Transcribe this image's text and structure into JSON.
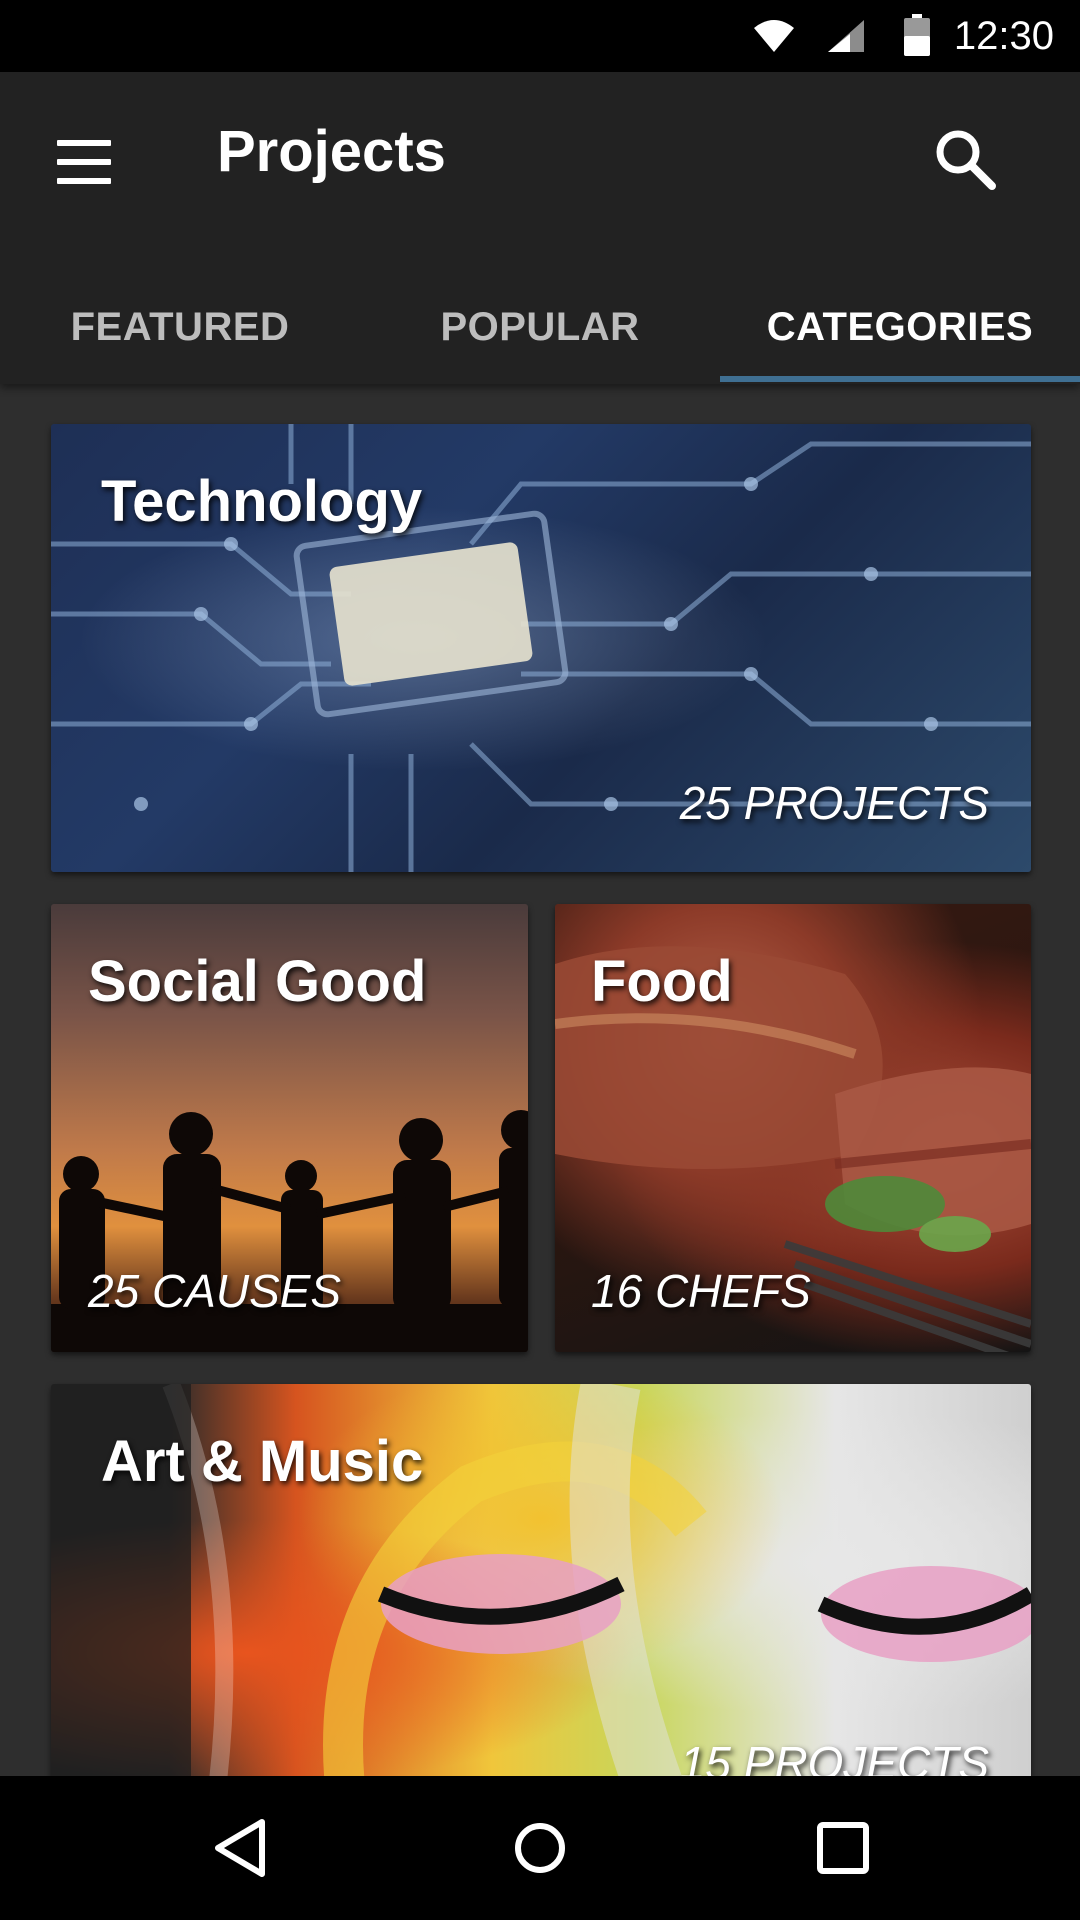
{
  "status_bar": {
    "time": "12:30",
    "icons": [
      "wifi-icon",
      "cell-signal-icon",
      "battery-icon"
    ]
  },
  "app_bar": {
    "title": "Projects",
    "menu_icon": "hamburger-menu-icon",
    "search_icon": "search-icon"
  },
  "tabs": [
    {
      "label": "FEATURED",
      "active": false
    },
    {
      "label": "POPULAR",
      "active": false
    },
    {
      "label": "CATEGORIES",
      "active": true
    }
  ],
  "categories": [
    {
      "title": "Technology",
      "count": "25 PROJECTS"
    },
    {
      "title": "Social Good",
      "count": "25 CAUSES"
    },
    {
      "title": "Food",
      "count": "16 CHEFS"
    },
    {
      "title": "Art & Music",
      "count": "15 PROJECTS"
    }
  ],
  "nav_bar": {
    "icons": [
      "back-icon",
      "home-icon",
      "recents-icon"
    ]
  },
  "colors": {
    "tab_indicator": "#3f6f92",
    "app_bar": "#222222",
    "background": "#2e2e2e"
  }
}
